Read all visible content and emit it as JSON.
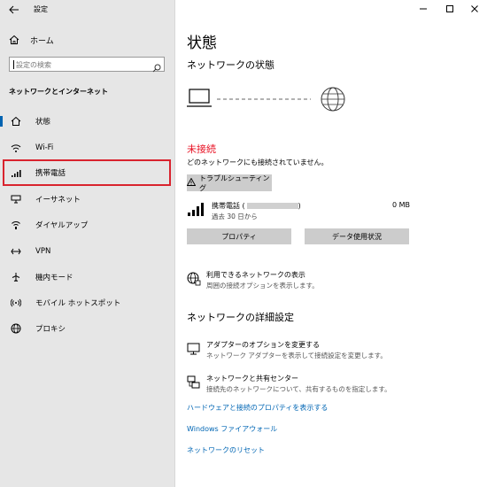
{
  "window": {
    "app_title": "設定",
    "controls": {
      "minimize": "—",
      "maximize": "☐",
      "close": "✕"
    }
  },
  "sidebar": {
    "home_label": "ホーム",
    "search_placeholder": "設定の検索",
    "section_title": "ネットワークとインターネット",
    "items": [
      {
        "label": "状態",
        "icon": "house-globe-icon",
        "selected": true
      },
      {
        "label": "Wi-Fi",
        "icon": "wifi-icon"
      },
      {
        "label": "携帯電話",
        "icon": "cellular-signal-icon",
        "highlighted": true
      },
      {
        "label": "イーサネット",
        "icon": "ethernet-icon"
      },
      {
        "label": "ダイヤルアップ",
        "icon": "dialup-icon"
      },
      {
        "label": "VPN",
        "icon": "vpn-icon"
      },
      {
        "label": "機内モード",
        "icon": "airplane-icon"
      },
      {
        "label": "モバイル ホットスポット",
        "icon": "hotspot-icon"
      },
      {
        "label": "プロキシ",
        "icon": "globe-icon"
      }
    ],
    "highlight_color": "#d9232e",
    "selected_color": "#0063b1"
  },
  "main": {
    "title": "状態",
    "network_status_heading": "ネットワークの状態",
    "status_text": "未接続",
    "status_color": "#e81123",
    "status_description": "どのネットワークにも接続されていません。",
    "troubleshoot_label": "トラブルシューティング",
    "connection": {
      "name": "携帯電話 (",
      "sub": "過去 30 日から",
      "size": "0 MB"
    },
    "properties_label": "プロパティ",
    "data_usage_label": "データ使用状況",
    "show_networks": {
      "title": "利用できるネットワークの表示",
      "desc": "周囲の接続オプションを表示します。"
    },
    "advanced_heading": "ネットワークの詳細設定",
    "adapter_options": {
      "title": "アダプターのオプションを変更する",
      "desc": "ネットワーク アダプターを表示して接続設定を変更します。"
    },
    "sharing_center": {
      "title": "ネットワークと共有センター",
      "desc": "接続先のネットワークについて、共有するものを指定します。"
    },
    "links": [
      "ハードウェアと接続のプロパティを表示する",
      "Windows ファイアウォール",
      "ネットワークのリセット"
    ],
    "link_color": "#0066b4"
  }
}
